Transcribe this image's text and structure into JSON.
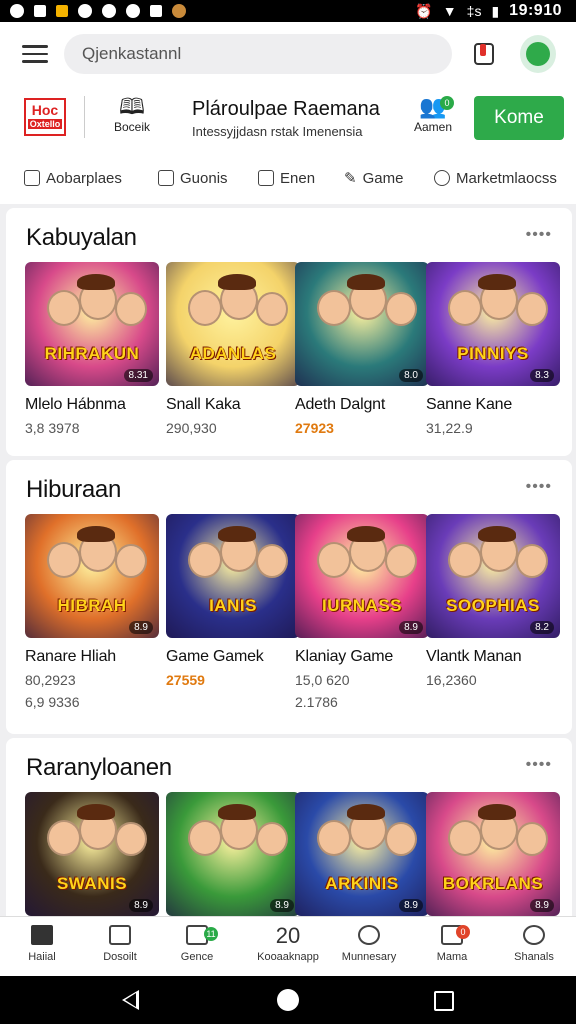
{
  "status_bar": {
    "time": "19:910",
    "signal_text": "‡s"
  },
  "top_bar": {
    "search_placeholder": "Qjenkastannl"
  },
  "brand_bar": {
    "logo_text": "Hoc",
    "logo_sub": "Oxtello",
    "item1_label": "Boceik",
    "title": "Plárоulpae Raemana",
    "subtitle": "Intessyjjdasn rstak Imenensia",
    "item2_label": "Aamen",
    "item2_badge": "0",
    "cta_label": "Kome"
  },
  "tabs": [
    {
      "label": "Aobarplaes",
      "icon": "checkbox-icon"
    },
    {
      "label": "Guonis",
      "icon": "chat-icon"
    },
    {
      "label": "Enen",
      "icon": "calendar-icon"
    },
    {
      "label": "Game",
      "icon": "pen-icon"
    },
    {
      "label": "Marketmlaocss",
      "icon": "face-icon"
    }
  ],
  "sections": [
    {
      "title": "Kabuyalan",
      "more": "••••",
      "cards": [
        {
          "name": "Mlelo Hábnma",
          "stat1": "3,8 3978",
          "stat2": "",
          "art": "RIHRAKUN",
          "rating": "8.31",
          "bg": "#d84a8a"
        },
        {
          "name": "Snall Kaka",
          "stat1": "290,930",
          "stat2": "",
          "art": "ADANLAS",
          "rating": "",
          "bg": "#f4d36a"
        },
        {
          "name": "Adeth Dalgnt",
          "stat1": "27923",
          "stat2": "",
          "art": "",
          "rating": "8.0",
          "bg": "#2b7a7a"
        },
        {
          "name": "Sanne Kane",
          "stat1": "31,22.9",
          "stat2": "",
          "art": "PINNIYS",
          "rating": "8.3",
          "bg": "#7b3cc6"
        }
      ]
    },
    {
      "title": "Hiburaan",
      "more": "••••",
      "cards": [
        {
          "name": "Ranare Hliah",
          "stat1": "80,2923",
          "stat2": "6,9 9336",
          "art": "HIBRAH",
          "rating": "8.9",
          "bg": "#e0702a"
        },
        {
          "name": "Game Gamek",
          "stat1": "27559",
          "stat2": "",
          "art": "IANIS",
          "rating": "",
          "bg": "#2a2f8a"
        },
        {
          "name": "Klaniay Game",
          "stat1": "15,0 620",
          "stat2": "2.1786",
          "art": "IURNASS",
          "rating": "8.9",
          "bg": "#e7408a"
        },
        {
          "name": "Vlantk Manan",
          "stat1": "16,2360",
          "stat2": "",
          "art": "SOOPHIAS",
          "rating": "8.2",
          "bg": "#6a3cb8"
        }
      ]
    },
    {
      "title": "Raranyloanen",
      "more": "••••",
      "cards": [
        {
          "name": "",
          "stat1": "",
          "stat2": "",
          "art": "SWANIS",
          "rating": "8.9",
          "bg": "#3a2a1a"
        },
        {
          "name": "",
          "stat1": "",
          "stat2": "",
          "art": "",
          "rating": "8.9",
          "bg": "#3a9a3a"
        },
        {
          "name": "",
          "stat1": "",
          "stat2": "",
          "art": "ARKINIS",
          "rating": "8.9",
          "bg": "#2a4aa8"
        },
        {
          "name": "",
          "stat1": "",
          "stat2": "",
          "art": "BOKRLANS",
          "rating": "8.9",
          "bg": "#d84a8a"
        }
      ]
    }
  ],
  "bottom_nav": [
    {
      "label": "Haiial",
      "icon": "home-icon"
    },
    {
      "label": "Dosoilt",
      "icon": "book-icon"
    },
    {
      "label": "Gence",
      "icon": "chat-badge-icon",
      "badge": "11"
    },
    {
      "label": "Kooaaknapp",
      "icon": "gift-icon",
      "glyph": "20"
    },
    {
      "label": "Munnesary",
      "icon": "clock-icon"
    },
    {
      "label": "Mama",
      "icon": "message-icon",
      "badge": "0"
    },
    {
      "label": "Shanals",
      "icon": "person-icon"
    }
  ]
}
